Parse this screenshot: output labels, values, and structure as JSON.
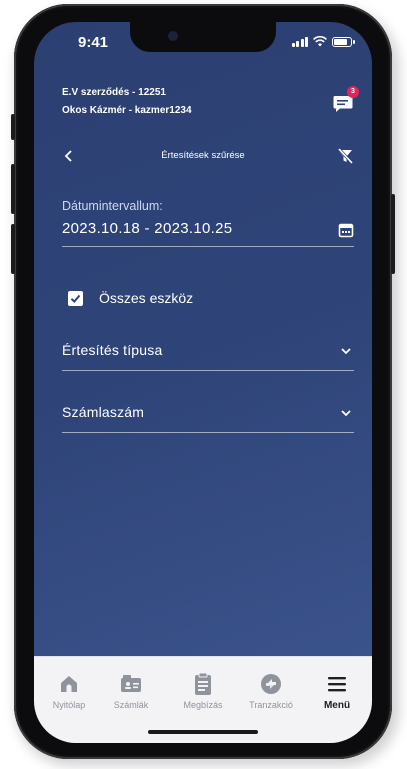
{
  "status_bar": {
    "time": "9:41"
  },
  "header": {
    "contract": "E.V szerződés - 12251",
    "user": "Okos Kázmér - kazmer1234",
    "chat_badge_count": "3",
    "chat_icon": "chat-icon"
  },
  "nav": {
    "title": "Értesítések szűrése",
    "back_icon": "chevron-left-icon",
    "clear_filter_icon": "filter-clear-icon"
  },
  "filters": {
    "date_label": "Dátumintervallum:",
    "date_value": "2023.10.18 - 2023.10.25",
    "calendar_icon": "calendar-icon",
    "all_devices_label": "Összes eszköz",
    "all_devices_checked": true,
    "notification_type_label": "Értesítés típusa",
    "account_number_label": "Számlaszám"
  },
  "tabbar": {
    "items": [
      {
        "label": "Nyitólap",
        "icon": "home-icon",
        "active": false
      },
      {
        "label": "Számlák",
        "icon": "account-card-icon",
        "active": false
      },
      {
        "label": "Megbízás",
        "icon": "clipboard-icon",
        "active": false
      },
      {
        "label": "Tranzakció",
        "icon": "transfer-icon",
        "active": false
      },
      {
        "label": "Menü",
        "icon": "menu-icon",
        "active": true
      }
    ]
  },
  "colors": {
    "screen_bg": "#2e4478",
    "tab_active": "#1d1f26",
    "tab_inactive": "#8f939c",
    "badge": "#e0245e"
  }
}
